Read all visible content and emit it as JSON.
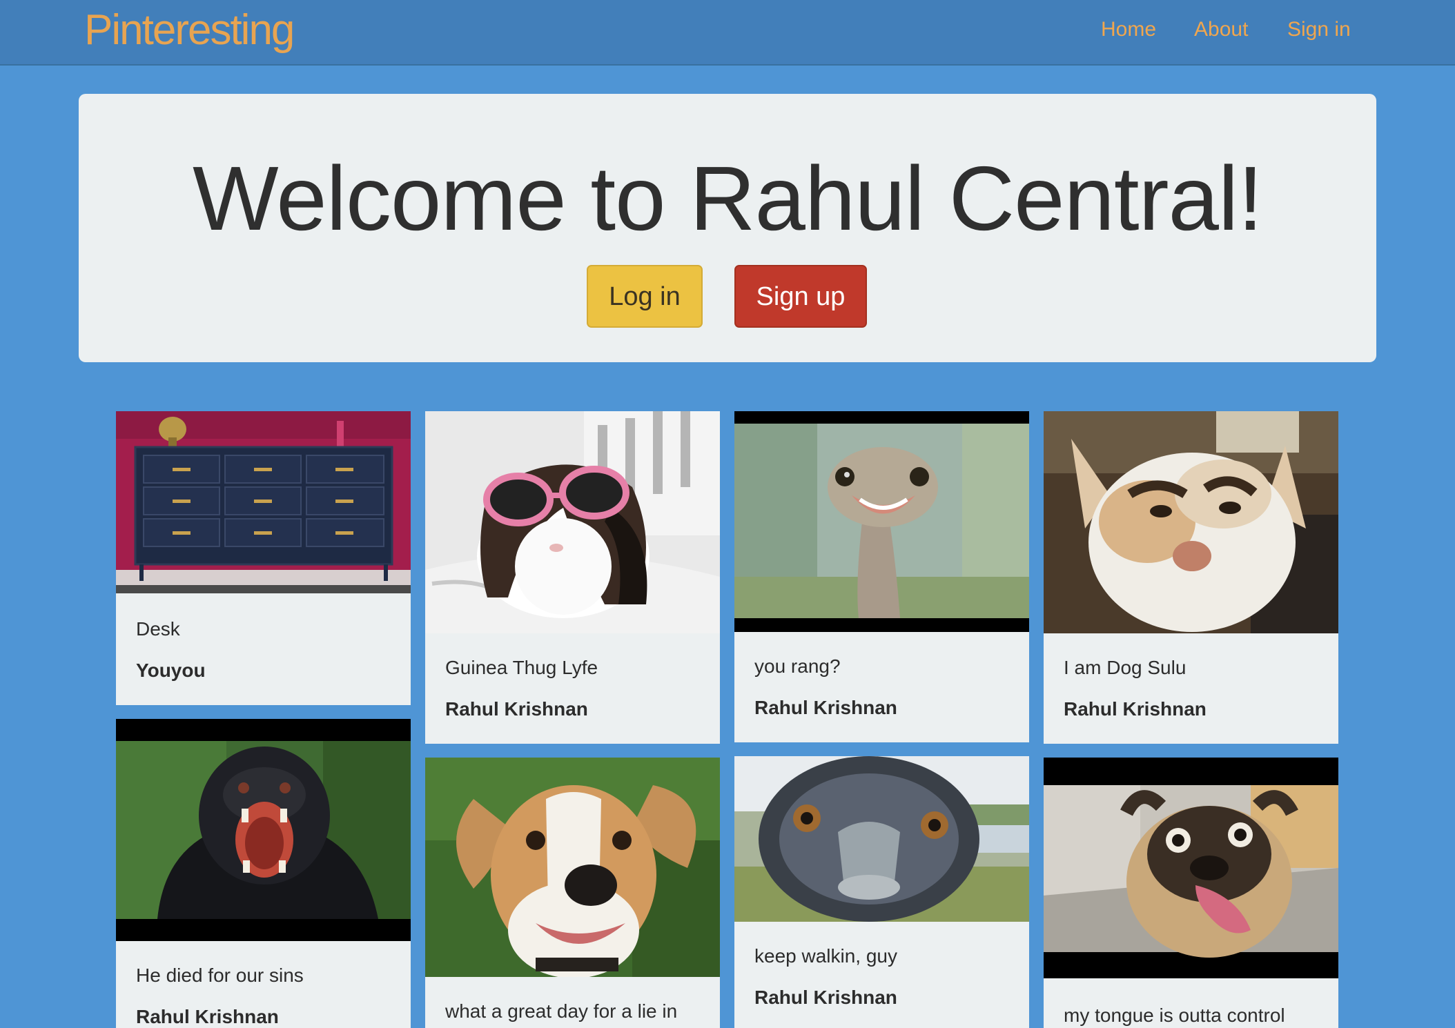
{
  "navbar": {
    "brand": "Pinteresting",
    "links": [
      "Home",
      "About",
      "Sign in"
    ]
  },
  "jumbotron": {
    "title": "Welcome to Rahul Central!",
    "login_label": "Log in",
    "signup_label": "Sign up"
  },
  "pins": [
    {
      "description": "Desk",
      "user": "Youyou",
      "image": "dresser"
    },
    {
      "description": "Guinea Thug Lyfe",
      "user": "Rahul Krishnan",
      "image": "guinea-pig-sunglasses"
    },
    {
      "description": "you rang?",
      "user": "Rahul Krishnan",
      "image": "ostrich-smiling"
    },
    {
      "description": "I am Dog Sulu",
      "user": "Rahul Krishnan",
      "image": "dog-eyebrows"
    },
    {
      "description": "He died for our sins",
      "user": "Rahul Krishnan",
      "image": "gorilla-roaring"
    },
    {
      "description": "what a great day for a lie in",
      "user": "",
      "image": "beagle-lying-grass"
    },
    {
      "description": "keep walkin, guy",
      "user": "Rahul Krishnan",
      "image": "emu-closeup"
    },
    {
      "description": "my tongue is outta control",
      "user": "",
      "image": "pug-tongue"
    }
  ],
  "colors": {
    "background": "#4f95d5",
    "navbar": "#427fba",
    "brand": "#e8a451",
    "login": "#ecc242",
    "signup": "#c0392b",
    "card": "#ecf0f1"
  }
}
